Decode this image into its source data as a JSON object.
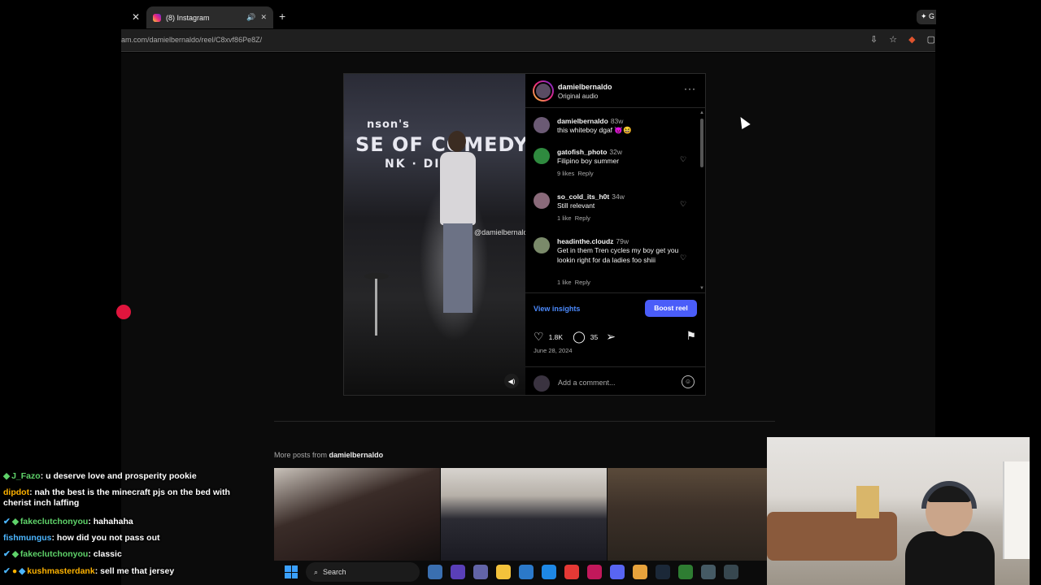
{
  "browser": {
    "tab_title": "(8) Instagram",
    "url": "am.com/damielbernaldo/reel/C8xvf86Pe8Z/"
  },
  "post": {
    "username": "damielbernaldo",
    "audio": "Original audio",
    "video_watermark": "@damielbernaldo",
    "comments": [
      {
        "user": "damielbernaldo",
        "age": "83w",
        "text": "this whiteboy dgaf 😈😆",
        "avatar_color": "#6b5a74"
      },
      {
        "user": "gatofish_photo",
        "age": "32w",
        "text": "Filipino boy summer",
        "likes": "9 likes",
        "reply": "Reply",
        "avatar_color": "#2f8a3f"
      },
      {
        "user": "so_cold_its_h0t",
        "age": "34w",
        "text": "Still relevant",
        "likes": "1 like",
        "reply": "Reply",
        "avatar_color": "#8a6a7a"
      },
      {
        "user": "headinthe.cloudz",
        "age": "79w",
        "text": "Get in them Tren cycles my boy get you lookin right for da ladies foo shiii",
        "likes": "1 like",
        "reply": "Reply",
        "avatar_color": "#7a8a6a"
      }
    ],
    "view_insights": "View insights",
    "boost": "Boost reel",
    "likes": "1.8K",
    "comment_count": "35",
    "date": "June 28, 2024",
    "add_comment_placeholder": "Add a comment..."
  },
  "more_posts": {
    "label": "More posts from",
    "user": "damielbernaldo"
  },
  "chat": [
    {
      "user": "J_Fazo",
      "color": "#5fd36a",
      "text": "u deserve love and prosperity pookie"
    },
    {
      "user": "dipdot",
      "color": "#ffb300",
      "text": "nah the best is the minecraft pjs on the bed with cherist inch laffing"
    },
    {
      "user": "fakeclutchonyou",
      "color": "#5fd36a",
      "text": "hahahaha"
    },
    {
      "user": "fishmungus",
      "color": "#4cb6ff",
      "text": "how did you not pass out"
    },
    {
      "user": "fakeclutchonyou",
      "color": "#5fd36a",
      "text": "classic"
    },
    {
      "user": "kushmasterdank",
      "color": "#ffb300",
      "text": "sell me that jersey"
    }
  ],
  "taskbar": {
    "search_label": "Search"
  }
}
